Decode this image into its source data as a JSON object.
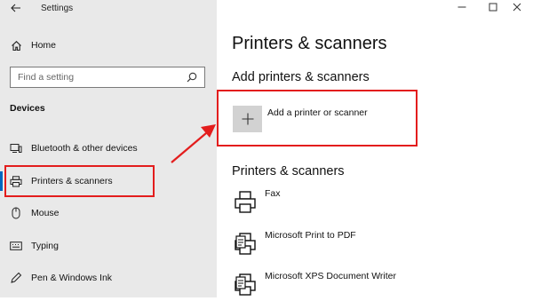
{
  "window": {
    "title": "Settings",
    "controls": [
      "minimize",
      "maximize",
      "close"
    ]
  },
  "sidebar": {
    "home_label": "Home",
    "search_placeholder": "Find a setting",
    "section_label": "Devices",
    "items": [
      {
        "label": "Bluetooth & other devices",
        "icon": "bluetooth-devices-icon"
      },
      {
        "label": "Printers & scanners",
        "icon": "printer-icon",
        "selected": true
      },
      {
        "label": "Mouse",
        "icon": "mouse-icon"
      },
      {
        "label": "Typing",
        "icon": "keyboard-icon"
      },
      {
        "label": "Pen & Windows Ink",
        "icon": "pen-icon"
      }
    ]
  },
  "main": {
    "title": "Printers & scanners",
    "add_section_title": "Add printers & scanners",
    "add_button_label": "Add a printer or scanner",
    "list_section_title": "Printers & scanners",
    "printers": [
      {
        "name": "Fax",
        "icon": "fax-printer-icon"
      },
      {
        "name": "Microsoft Print to PDF",
        "icon": "pdf-printer-icon"
      },
      {
        "name": "Microsoft XPS Document Writer",
        "icon": "xps-printer-icon"
      }
    ]
  },
  "colors": {
    "sidebar_bg": "#e9e9e9",
    "accent": "#0067c0",
    "annotation_red": "#e31d1d",
    "add_button_bg": "#d2d2d2"
  }
}
